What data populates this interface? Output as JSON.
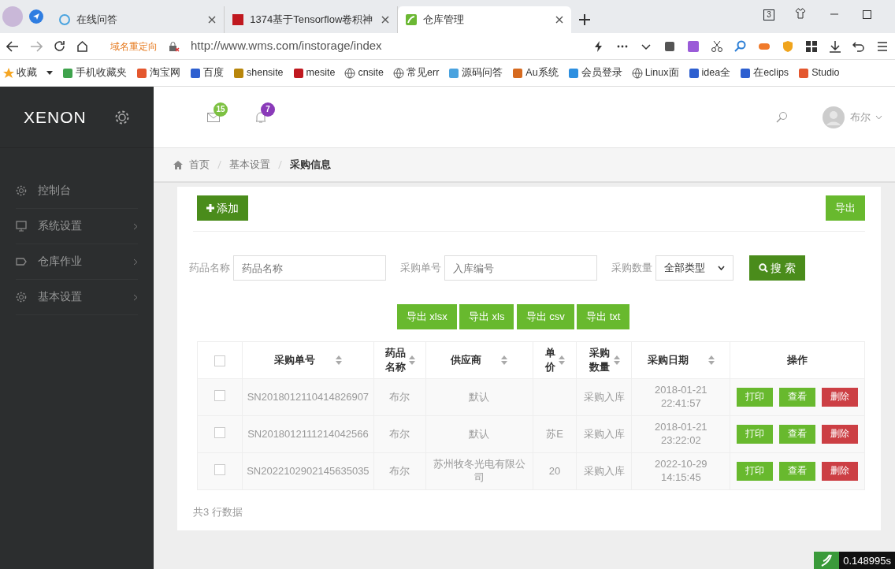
{
  "browser": {
    "tabs": [
      {
        "title": "在线问答",
        "selected": false
      },
      {
        "title": "1374基于Tensorflow卷积神",
        "selected": false
      },
      {
        "title": "仓库管理",
        "selected": true
      }
    ],
    "tab_count": "3",
    "redirect_note": "域名重定向",
    "url": "http://www.wms.com/instorage/index",
    "bookmarks": [
      "收藏",
      "手机收藏夹",
      "淘宝网",
      "百度",
      "shensite",
      "mesite",
      "cnsite",
      "常见err",
      "源码问答",
      "Au系统",
      "会员登录",
      "Linux面",
      "idea全",
      "在eclips",
      "Studio"
    ]
  },
  "app": {
    "brand": "XENON",
    "sidebar": [
      {
        "label": "控制台",
        "expandable": false
      },
      {
        "label": "系统设置",
        "expandable": true
      },
      {
        "label": "仓库作业",
        "expandable": true
      },
      {
        "label": "基本设置",
        "expandable": true
      }
    ],
    "header": {
      "mail_count": "15",
      "notice_count": "7",
      "user": "布尔"
    },
    "breadcrumb": [
      {
        "label": "首页",
        "current": false
      },
      {
        "label": "基本设置",
        "current": false
      },
      {
        "label": "采购信息",
        "current": true
      }
    ],
    "add_button": "添加",
    "export_button": "导出",
    "filters": [
      {
        "kind": "input",
        "label": "药品名称",
        "placeholder": "药品名称"
      },
      {
        "kind": "input",
        "label": "采购单号",
        "placeholder": "入库编号"
      },
      {
        "kind": "select",
        "label": "采购数量",
        "value": "全部类型"
      }
    ],
    "search_button": "搜 索",
    "export_buttons": [
      "导出 xlsx",
      "导出 xls",
      "导出 csv",
      "导出 txt"
    ],
    "table": {
      "select_all_checked": false,
      "columns": [
        {
          "label": "采购单号",
          "sortable": true
        },
        {
          "label": "药品名称",
          "sortable": true
        },
        {
          "label": "供应商",
          "sortable": true
        },
        {
          "label": "单价",
          "sortable": true
        },
        {
          "label": "采购数量",
          "sortable": true
        },
        {
          "label": "采购日期",
          "sortable": true
        },
        {
          "label": "操作",
          "sortable": false
        }
      ],
      "rows": [
        {
          "checked": false,
          "cells": [
            "SN2018012110414826907",
            "布尔",
            "默认",
            "",
            "采购入库",
            "2018-01-21 22:41:57"
          ],
          "actions": [
            {
              "kind": "print",
              "label": "打印"
            },
            {
              "kind": "view",
              "label": "查看"
            },
            {
              "kind": "delete",
              "label": "删除"
            }
          ]
        },
        {
          "checked": false,
          "cells": [
            "SN2018012111214042566",
            "布尔",
            "默认",
            "苏E",
            "采购入库",
            "2018-01-21 23:22:02"
          ],
          "actions": [
            {
              "kind": "print",
              "label": "打印"
            },
            {
              "kind": "view",
              "label": "查看"
            },
            {
              "kind": "delete",
              "label": "删除"
            }
          ]
        },
        {
          "checked": false,
          "cells": [
            "SN2022102902145635035",
            "布尔",
            "苏州牧冬光电有限公司",
            "20",
            "采购入库",
            "2022-10-29 14:15:45"
          ],
          "actions": [
            {
              "kind": "print",
              "label": "打印"
            },
            {
              "kind": "view",
              "label": "查看"
            },
            {
              "kind": "delete",
              "label": "删除"
            }
          ]
        }
      ]
    },
    "row_count": "共3 行数据",
    "timer": "0.148995s"
  }
}
